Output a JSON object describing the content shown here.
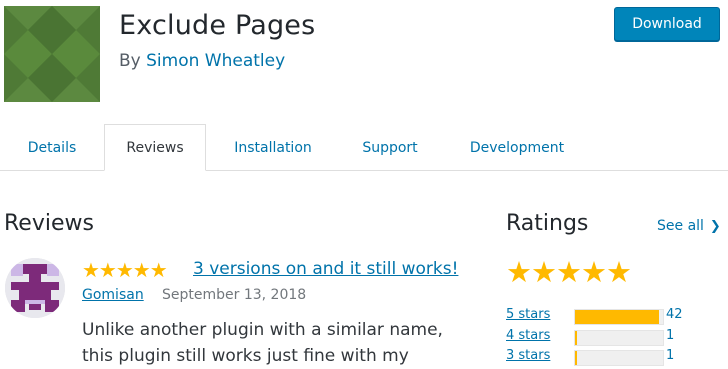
{
  "plugin": {
    "title": "Exclude Pages",
    "by_prefix": "By",
    "author": "Simon Wheatley",
    "download_label": "Download"
  },
  "tabs": [
    {
      "label": "Details"
    },
    {
      "label": "Reviews"
    },
    {
      "label": "Installation"
    },
    {
      "label": "Support"
    },
    {
      "label": "Development"
    }
  ],
  "reviews": {
    "heading": "Reviews",
    "items": [
      {
        "stars": "★★★★★",
        "title": "3 versions on and it still works!",
        "reviewer": "Gomisan",
        "date": "September 13, 2018",
        "body": "Unlike another plugin with a similar name, this plugin still works just fine with my"
      }
    ]
  },
  "ratings": {
    "heading": "Ratings",
    "see_all": "See all",
    "overall_stars": "★★★★★",
    "rows": [
      {
        "label": "5 stars",
        "count": "42",
        "fraction": 0.95
      },
      {
        "label": "4 stars",
        "count": "1",
        "fraction": 0.02
      },
      {
        "label": "3 stars",
        "count": "1",
        "fraction": 0.02
      }
    ]
  },
  "colors": {
    "accent": "#0073aa",
    "button": "#0085ba",
    "star": "#ffb900",
    "icon_bg": "#4f7a36"
  },
  "icons": {
    "see_all": "chevron-right-icon"
  }
}
